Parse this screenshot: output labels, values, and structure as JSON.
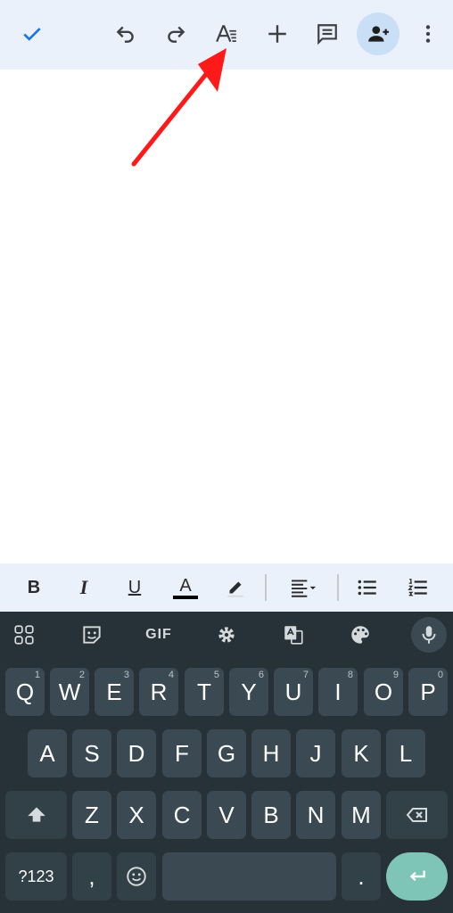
{
  "toolbar": {
    "icons": [
      "check-icon",
      "undo-icon",
      "redo-icon",
      "text-format-icon",
      "add-icon",
      "comment-icon",
      "add-person-icon",
      "more-vert-icon"
    ]
  },
  "format_bar": {
    "bold": "B",
    "italic": "I",
    "underline": "U",
    "text_color": "A"
  },
  "keyboard": {
    "suggestion_gif": "GIF",
    "row1": [
      {
        "key": "Q",
        "hint": "1"
      },
      {
        "key": "W",
        "hint": "2"
      },
      {
        "key": "E",
        "hint": "3"
      },
      {
        "key": "R",
        "hint": "4"
      },
      {
        "key": "T",
        "hint": "5"
      },
      {
        "key": "Y",
        "hint": "6"
      },
      {
        "key": "U",
        "hint": "7"
      },
      {
        "key": "I",
        "hint": "8"
      },
      {
        "key": "O",
        "hint": "9"
      },
      {
        "key": "P",
        "hint": "0"
      }
    ],
    "row2": [
      "A",
      "S",
      "D",
      "F",
      "G",
      "H",
      "J",
      "K",
      "L"
    ],
    "row3": [
      "Z",
      "X",
      "C",
      "V",
      "B",
      "N",
      "M"
    ],
    "symbols_label": "?123",
    "comma_label": ",",
    "period_label": "."
  },
  "colors": {
    "accent": "#1a73e8",
    "arrow": "#ff1a1a",
    "keyboard_bg": "#263238",
    "key_bg": "#3b4a52",
    "enter_bg": "#7ec4b7"
  }
}
